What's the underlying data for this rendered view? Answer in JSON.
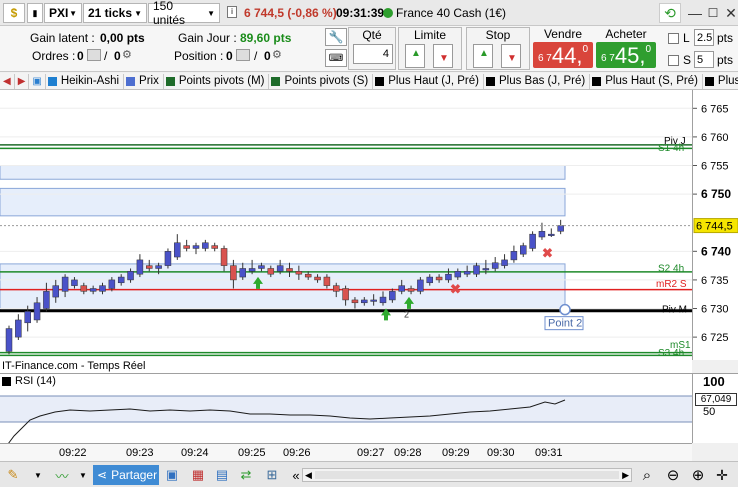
{
  "header": {
    "symbol": "PXI",
    "interval": "21 ticks",
    "units": "150 unités",
    "price_change": "6 744,5 (-0,86 %)",
    "time": "09:31:39",
    "instrument": "France 40 Cash (1€)"
  },
  "positions": {
    "gain_latent_label": "Gain latent :",
    "gain_latent_value": "0,00 pts",
    "gain_jour_label": "Gain Jour :",
    "gain_jour_value": "89,60 pts",
    "orders_label": "Ordres :",
    "orders_count_a": "0",
    "orders_count_b": "0",
    "position_label": "Position :",
    "position_count_a": "0",
    "position_count_b": "0"
  },
  "order_panel": {
    "qty_label": "Qté",
    "qty_value": "4",
    "limit_label": "Limite",
    "stop_label": "Stop",
    "sell_label": "Vendre",
    "sell_small": "6 7",
    "sell_big": "44,",
    "sell_sup": "0",
    "buy_label": "Acheter",
    "buy_small": "6 7",
    "buy_big": "45,",
    "buy_sup": "0",
    "l_label": "L",
    "l_value": "2.5",
    "s_label": "S",
    "s_value": "5",
    "pts_label": "pts",
    "sell_color": "#d9453b",
    "buy_color": "#2f9e2f"
  },
  "tabs": [
    {
      "label": "Heikin-Ashi",
      "color": "#1e7fd0"
    },
    {
      "label": "Prix",
      "color": "#4d6ed0"
    },
    {
      "label": "Points pivots (M)",
      "color": "#1e6b2a"
    },
    {
      "label": "Points pivots (S)",
      "color": "#1e6b2a"
    },
    {
      "label": "Plus Haut (J, Pré)",
      "color": "#000000"
    },
    {
      "label": "Plus Bas (J, Pré)",
      "color": "#000000"
    },
    {
      "label": "Plus Haut (S, Pré)",
      "color": "#000000"
    },
    {
      "label": "Plus",
      "color": "#000000"
    }
  ],
  "chart": {
    "source": "IT-Finance.com - Temps Réel",
    "rsi_label": "RSI (14)",
    "rsi_value": "67,049",
    "current_price": "6 744,5",
    "point_label": "Point 2",
    "marker_num": "2",
    "ytick_labels": [
      "6 765",
      "6 760",
      "6 755",
      "6 750",
      "6 740",
      "6 735",
      "6 730",
      "6 725"
    ],
    "rsi_ticks": [
      "100",
      "50"
    ],
    "line_labels": {
      "piv_j": "Piv J",
      "s1_4h": "S1 4h",
      "s2_4h": "S2 4h",
      "mr2_s": "mR2 S",
      "piv_m": "Piv M",
      "ms1": "mS1",
      "s3_4h": "S3 4h"
    },
    "xtick_labels": [
      "09:22",
      "09:23",
      "09:24",
      "09:25",
      "09:26",
      "09:27",
      "09:28",
      "09:29",
      "09:30",
      "09:31"
    ]
  },
  "chart_data": {
    "type": "candlestick",
    "ylim": [
      6721.0,
      6768.2
    ],
    "yticks": [
      6765,
      6760,
      6755,
      6750,
      6740,
      6735,
      6730,
      6725
    ],
    "levels": [
      {
        "name": "Piv J",
        "value": 6758.6,
        "color": "#1e6b2a"
      },
      {
        "name": "S1 4h",
        "value": 6758.0,
        "color": "#1e8a2a"
      },
      {
        "name": "S2 4h",
        "value": 6736.4,
        "color": "#1e8a2a"
      },
      {
        "name": "mR2 S",
        "value": 6733.3,
        "color": "#e02020"
      },
      {
        "name": "Piv M",
        "value": 6729.6,
        "color": "#000000"
      },
      {
        "name": "mS1",
        "value": 6722.3,
        "color": "#1e8a2a"
      },
      {
        "name": "S3 4h",
        "value": 6721.8,
        "color": "#1e8a2a"
      }
    ],
    "candles": [
      [
        6722.5,
        6726.5,
        6722.0,
        6727.0
      ],
      [
        6725.0,
        6728.0,
        6724.5,
        6729.0
      ],
      [
        6727.5,
        6729.5,
        6726.0,
        6730.5
      ],
      [
        6728.0,
        6731.0,
        6727.5,
        6732.0
      ],
      [
        6730.0,
        6733.0,
        6729.5,
        6734.5
      ],
      [
        6732.0,
        6734.0,
        6731.0,
        6735.0
      ],
      [
        6733.0,
        6735.5,
        6732.0,
        6736.0
      ],
      [
        6734.0,
        6735.0,
        6733.5,
        6735.5
      ],
      [
        6734.0,
        6733.0,
        6732.5,
        6734.5
      ],
      [
        6733.0,
        6733.5,
        6732.5,
        6734.0
      ],
      [
        6733.0,
        6734.0,
        6732.5,
        6734.5
      ],
      [
        6733.5,
        6735.0,
        6733.0,
        6735.5
      ],
      [
        6734.5,
        6735.5,
        6734.0,
        6736.0
      ],
      [
        6735.0,
        6736.5,
        6734.5,
        6737.0
      ],
      [
        6736.0,
        6738.5,
        6735.5,
        6739.5
      ],
      [
        6737.5,
        6737.0,
        6736.5,
        6738.5
      ],
      [
        6737.0,
        6737.5,
        6736.0,
        6738.0
      ],
      [
        6737.5,
        6740.0,
        6737.0,
        6740.5
      ],
      [
        6739.0,
        6741.5,
        6738.5,
        6743.0
      ],
      [
        6741.0,
        6740.5,
        6740.0,
        6742.0
      ],
      [
        6740.5,
        6741.0,
        6739.5,
        6741.5
      ],
      [
        6740.5,
        6741.5,
        6740.0,
        6742.0
      ],
      [
        6741.0,
        6740.5,
        6740.0,
        6741.5
      ],
      [
        6740.5,
        6737.5,
        6736.5,
        6741.0
      ],
      [
        6737.5,
        6735.0,
        6733.5,
        6738.5
      ],
      [
        6735.5,
        6737.0,
        6735.0,
        6738.0
      ],
      [
        6736.5,
        6737.0,
        6736.0,
        6738.5
      ],
      [
        6737.0,
        6737.5,
        6736.5,
        6738.0
      ],
      [
        6737.0,
        6736.0,
        6735.5,
        6737.5
      ],
      [
        6736.5,
        6737.5,
        6736.0,
        6738.5
      ],
      [
        6737.0,
        6736.5,
        6735.5,
        6738.0
      ],
      [
        6736.5,
        6736.0,
        6735.0,
        6737.5
      ],
      [
        6736.0,
        6735.5,
        6735.0,
        6736.5
      ],
      [
        6735.5,
        6735.0,
        6734.5,
        6736.0
      ],
      [
        6735.5,
        6734.0,
        6733.5,
        6736.0
      ],
      [
        6734.0,
        6733.0,
        6732.0,
        6734.5
      ],
      [
        6733.5,
        6731.5,
        6730.5,
        6734.0
      ],
      [
        6731.5,
        6731.0,
        6730.0,
        6732.0
      ],
      [
        6731.0,
        6731.5,
        6730.5,
        6732.0
      ],
      [
        6731.5,
        6731.5,
        6730.5,
        6732.5
      ],
      [
        6731.0,
        6732.0,
        6730.5,
        6733.0
      ],
      [
        6731.5,
        6733.0,
        6731.0,
        6733.5
      ],
      [
        6733.0,
        6734.0,
        6732.5,
        6735.0
      ],
      [
        6733.5,
        6733.0,
        6732.5,
        6734.0
      ],
      [
        6733.0,
        6735.0,
        6732.5,
        6735.5
      ],
      [
        6734.5,
        6735.5,
        6734.0,
        6736.0
      ],
      [
        6735.5,
        6735.0,
        6734.5,
        6736.0
      ],
      [
        6735.0,
        6736.0,
        6734.5,
        6737.0
      ],
      [
        6735.5,
        6736.5,
        6735.0,
        6737.0
      ],
      [
        6736.0,
        6736.5,
        6735.5,
        6737.5
      ],
      [
        6736.0,
        6737.5,
        6735.5,
        6738.0
      ],
      [
        6737.0,
        6737.0,
        6736.0,
        6738.5
      ],
      [
        6737.0,
        6738.0,
        6736.5,
        6739.0
      ],
      [
        6737.5,
        6738.5,
        6737.0,
        6739.5
      ],
      [
        6738.5,
        6740.0,
        6738.0,
        6741.0
      ],
      [
        6739.5,
        6741.0,
        6739.0,
        6741.5
      ],
      [
        6740.5,
        6743.0,
        6740.0,
        6743.5
      ],
      [
        6742.5,
        6743.5,
        6742.0,
        6745.0
      ],
      [
        6743.0,
        6743.0,
        6742.5,
        6744.0
      ],
      [
        6743.5,
        6744.5,
        6743.0,
        6745.5
      ]
    ]
  }
}
